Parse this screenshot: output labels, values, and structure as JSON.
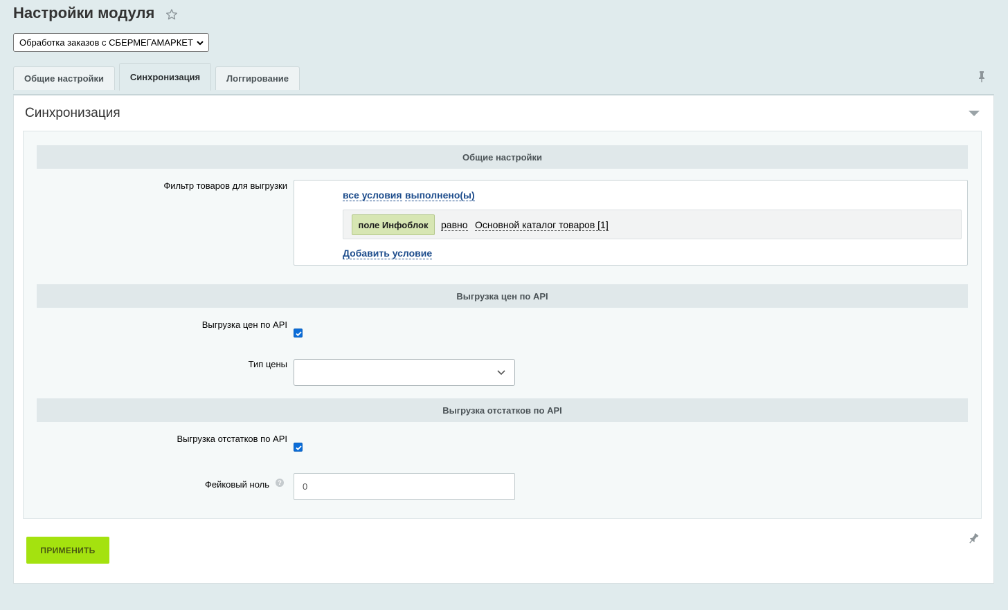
{
  "page": {
    "title": "Настройки модуля"
  },
  "module_select": {
    "value": "Обработка заказов с СБЕРМЕГАМАРКЕТ"
  },
  "tabs": [
    {
      "label": "Общие настройки",
      "active": false
    },
    {
      "label": "Синхронизация",
      "active": true
    },
    {
      "label": "Логгирование",
      "active": false
    }
  ],
  "section": {
    "title": "Синхронизация"
  },
  "general": {
    "header": "Общие настройки",
    "filter_label": "Фильтр товаров для выгрузки",
    "all_conditions_link": "все условия",
    "fulfilled_link": "выполнено(ы)",
    "condition": {
      "field": "поле Инфоблок",
      "operator": "равно",
      "value": "Основной каталог товаров [1]"
    },
    "add_condition_link": "Добавить условие"
  },
  "prices": {
    "header": "Выгрузка цен по API",
    "checkbox_label": "Выгрузка цен по API",
    "checked": true,
    "price_type_label": "Тип цены",
    "price_type_value": ""
  },
  "stocks": {
    "header": "Выгрузка отстатков по API",
    "checkbox_label": "Выгрузка отстатков по API",
    "checked": true,
    "fake_zero_label": "Фейковый ноль",
    "fake_zero_value": "0",
    "help_glyph": "?"
  },
  "apply_button": {
    "label": "ПРИМЕНИТЬ",
    "color": "#a4e20f"
  },
  "colors": {
    "background": "#e0ebed",
    "link": "#1e4d8c",
    "checkbox": "#0b6dd8"
  }
}
